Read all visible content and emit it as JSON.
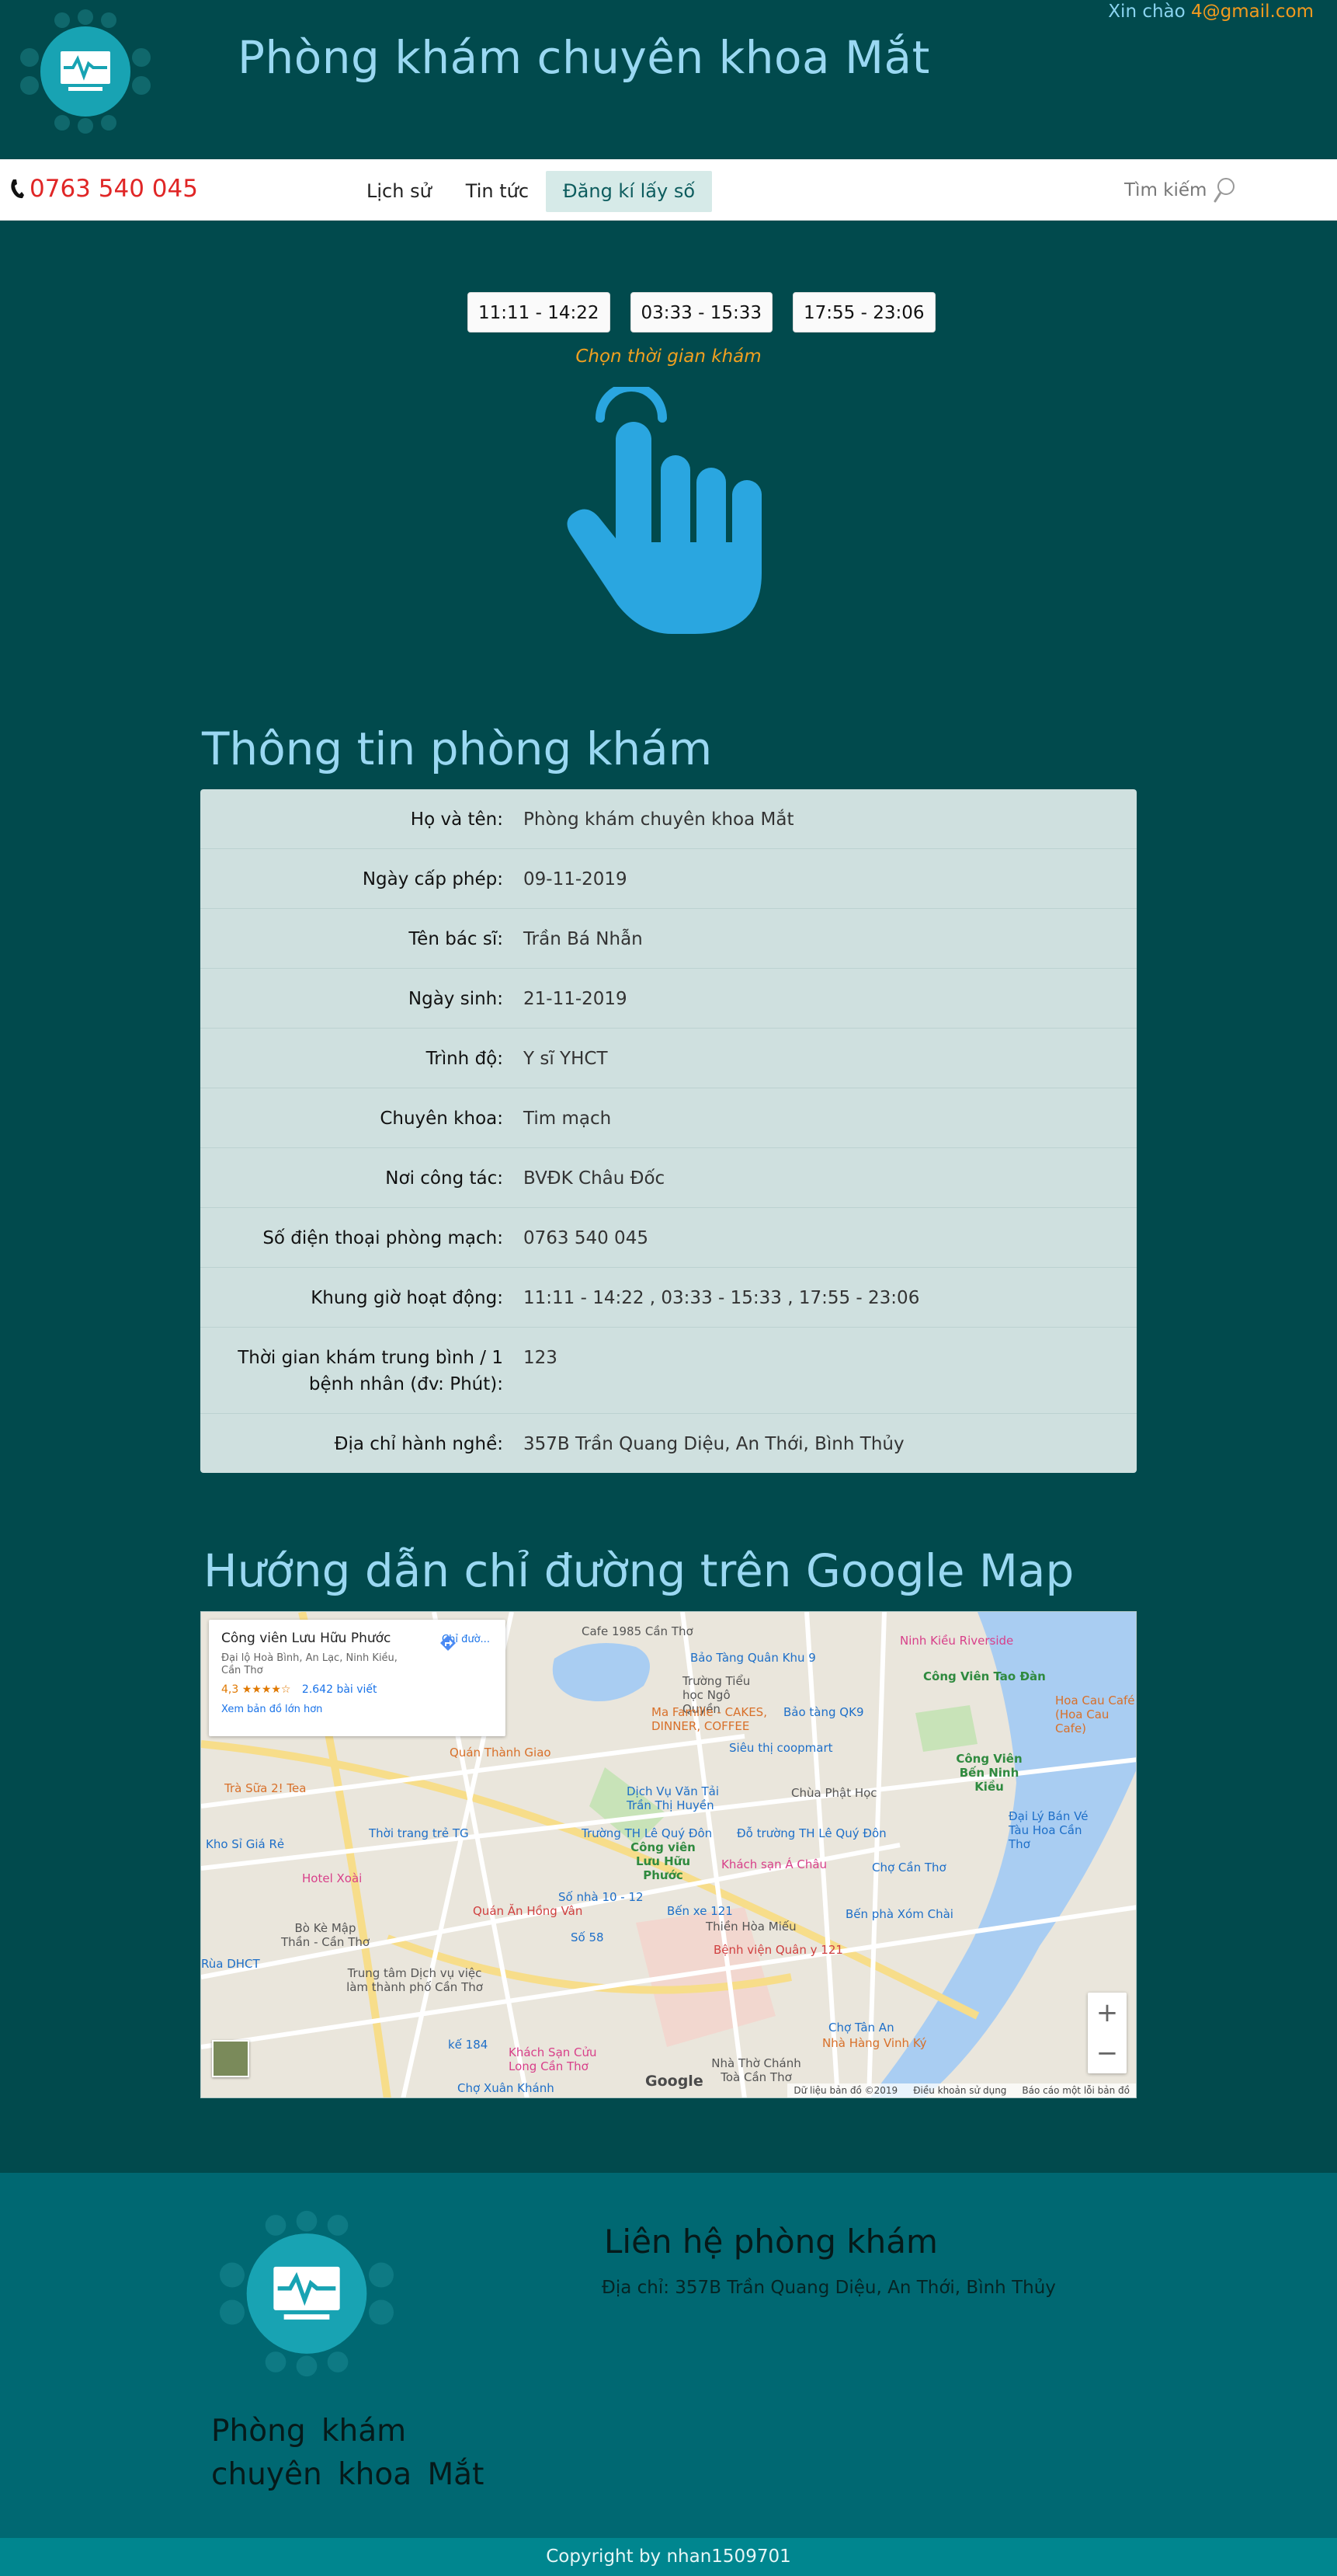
{
  "header": {
    "site_title": "Phòng khám chuyên khoa Mắt",
    "greeting_prefix": "Xin chào",
    "greeting_user": "4@gmail.com"
  },
  "navbar": {
    "phone": "0763 540 045",
    "items": [
      {
        "label": "Lịch sử",
        "active": false
      },
      {
        "label": "Tin tức",
        "active": false
      },
      {
        "label": "Đăng kí lấy số",
        "active": true
      }
    ],
    "search_label": "Tìm kiếm"
  },
  "booking": {
    "slots": [
      "11:11 - 14:22",
      "03:33 - 15:33",
      "17:55 - 23:06"
    ],
    "hint": "Chọn thời gian khám"
  },
  "info": {
    "title": "Thông tin phòng khám",
    "rows": [
      {
        "label": "Họ và tên:",
        "value": "Phòng khám chuyên khoa Mắt"
      },
      {
        "label": "Ngày cấp phép:",
        "value": "09-11-2019"
      },
      {
        "label": "Tên bác sĩ:",
        "value": "Trần Bá Nhẫn"
      },
      {
        "label": "Ngày sinh:",
        "value": "21-11-2019"
      },
      {
        "label": "Trình độ:",
        "value": "Y sĩ YHCT"
      },
      {
        "label": "Chuyên khoa:",
        "value": "Tim mạch"
      },
      {
        "label": "Nơi công tác:",
        "value": "BVĐK Châu Đốc"
      },
      {
        "label": "Số điện thoại phòng mạch:",
        "value": "0763 540 045"
      },
      {
        "label": "Khung giờ hoạt động:",
        "value": "11:11 - 14:22 , 03:33 - 15:33 , 17:55 - 23:06"
      },
      {
        "label": "Thời gian khám trung bình / 1 bệnh nhân (đv: Phút):",
        "value": "123"
      },
      {
        "label": "Địa chỉ hành nghề:",
        "value": "357B Trần Quang Diệu, An Thới, Bình Thủy"
      }
    ]
  },
  "map": {
    "title": "Hướng dẫn chỉ đường trên Google Map",
    "card": {
      "name": "Công viên Lưu Hữu Phước",
      "address": "Đại lộ Hoà Bình, An Lạc, Ninh Kiều, Cần Thơ",
      "rating": "4,3 ★★★★☆",
      "reviews": "2.642 bài viết",
      "larger_map": "Xem bản đồ lớn hơn",
      "directions": "Chỉ đườ..."
    },
    "labels": [
      {
        "text": "Cafe 1985 Cần Thơ",
        "style": ""
      },
      {
        "text": "Bảo Tàng Quân Khu 9",
        "style": "blue"
      },
      {
        "text": "Ninh Kiều Riverside",
        "style": "pink"
      },
      {
        "text": "Công Viên Tao Đàn",
        "style": "green"
      },
      {
        "text": "Trường Tiểu học Ngô Quyền",
        "style": ""
      },
      {
        "text": "Ma Famille - CAKES, DINNER, COFFEE",
        "style": "orange"
      },
      {
        "text": "Bảo tàng QK9",
        "style": "blue"
      },
      {
        "text": "Hoa Cau Café (Hoa Cau Cafe)",
        "style": "orange"
      },
      {
        "text": "Siêu thị coopmart",
        "style": "blue"
      },
      {
        "text": "Quán Thành Giao",
        "style": "orange"
      },
      {
        "text": "Công Viên Bến Ninh Kiều",
        "style": "green"
      },
      {
        "text": "Trà Sữa 2! Tea",
        "style": "orange"
      },
      {
        "text": "Dịch Vụ Văn Tải Trần Thị Huyền",
        "style": "blue"
      },
      {
        "text": "Chùa Phật Học",
        "style": ""
      },
      {
        "text": "Thời trang trẻ TG",
        "style": "blue"
      },
      {
        "text": "Trường TH Lê Quý Đôn",
        "style": "blue"
      },
      {
        "text": "Đỗ trường TH Lê Quý Đôn",
        "style": "blue"
      },
      {
        "text": "Đại Lý Bán Vé Tàu Hoa Cần Thơ",
        "style": "blue"
      },
      {
        "text": "Kho Sỉ Giá Rẻ",
        "style": "blue"
      },
      {
        "text": "Công viên Lưu Hữu Phước",
        "style": "green"
      },
      {
        "text": "Hotel Xoài",
        "style": "pink"
      },
      {
        "text": "Khách sạn Á Châu",
        "style": "pink"
      },
      {
        "text": "Chợ Cần Thơ",
        "style": "blue"
      },
      {
        "text": "Số nhà 10 - 12",
        "style": "blue"
      },
      {
        "text": "Bến xe 121",
        "style": "blue"
      },
      {
        "text": "Bến phà Xóm Chài",
        "style": "blue"
      },
      {
        "text": "Quán Ăn Hồng Vân",
        "style": "red"
      },
      {
        "text": "Thiền Hòa Miếu",
        "style": ""
      },
      {
        "text": "Bò Kè Mập Thần - Cần Thơ",
        "style": ""
      },
      {
        "text": "Số 58",
        "style": "blue"
      },
      {
        "text": "Bệnh viện Quân y 121",
        "style": "red"
      },
      {
        "text": "Rùa DHCT",
        "style": "blue"
      },
      {
        "text": "Trung tâm Dịch vụ việc làm thành phố Cần Thơ",
        "style": ""
      },
      {
        "text": "Chợ Tân An",
        "style": "blue"
      },
      {
        "text": "Nhà Hàng Vinh Ký",
        "style": "orange"
      },
      {
        "text": "kế 184",
        "style": "blue"
      },
      {
        "text": "Khách Sạn Cửu Long Cần Thơ",
        "style": "pink"
      },
      {
        "text": "Nhà Thờ Chánh Toà Cần Thơ",
        "style": ""
      },
      {
        "text": "Chợ Xuân Khánh",
        "style": "blue"
      }
    ],
    "footer": [
      "Dữ liệu bản đồ ©2019",
      "Điều khoản sử dụng",
      "Báo cáo một lỗi bản đồ"
    ],
    "google": "Google"
  },
  "footer": {
    "brand": "Phòng khám chuyên khoa Mắt",
    "contact_title": "Liên hệ phòng khám",
    "contact_address": "Địa chỉ: 357B Trần Quang Diệu, An Thới, Bình Thủy",
    "copyright": "Copyright by nhan1509701"
  },
  "colors": {
    "background": "#014a4d",
    "title": "#9ad8f2",
    "footer": "#006872",
    "copyright_bar": "#00868f",
    "hand_icon": "#2aa6e0",
    "phone": "#e02626",
    "hint": "#f0a020"
  }
}
